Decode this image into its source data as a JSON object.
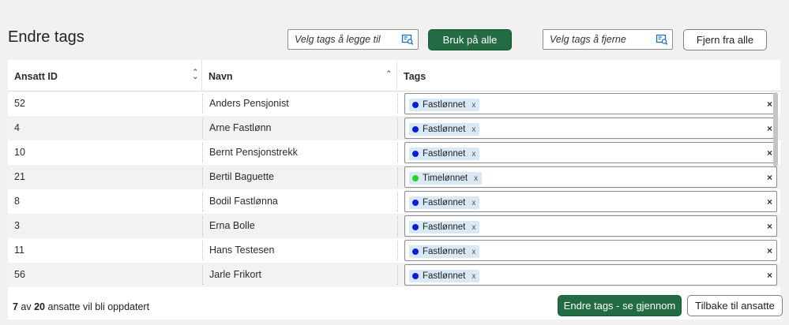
{
  "page": {
    "title": "Endre tags"
  },
  "toolbar": {
    "add_placeholder": "Velg tags å legge til",
    "apply_label": "Bruk på alle",
    "remove_placeholder": "Velg tags å fjerne",
    "remove_all_label": "Fjern fra alle"
  },
  "table": {
    "headers": {
      "id": "Ansatt ID",
      "name": "Navn",
      "tags": "Tags"
    },
    "rows": [
      {
        "id": "52",
        "name": "Anders Pensjonist",
        "tag": "Fastlønnet",
        "tag_color": "#0a1ed6"
      },
      {
        "id": "4",
        "name": "Arne Fastlønn",
        "tag": "Fastlønnet",
        "tag_color": "#0a1ed6"
      },
      {
        "id": "10",
        "name": "Bernt Pensjonstrekk",
        "tag": "Fastlønnet",
        "tag_color": "#0a1ed6"
      },
      {
        "id": "21",
        "name": "Bertil Baguette",
        "tag": "Timelønnet",
        "tag_color": "#1fd81f"
      },
      {
        "id": "8",
        "name": "Bodil Fastlønna",
        "tag": "Fastlønnet",
        "tag_color": "#0a1ed6"
      },
      {
        "id": "3",
        "name": "Erna Bolle",
        "tag": "Fastlønnet",
        "tag_color": "#0a1ed6"
      },
      {
        "id": "11",
        "name": "Hans Testesen",
        "tag": "Fastlønnet",
        "tag_color": "#0a1ed6"
      },
      {
        "id": "56",
        "name": "Jarle Frikort",
        "tag": "Fastlønnet",
        "tag_color": "#0a1ed6"
      }
    ],
    "chip_remove": "x",
    "clear": "×"
  },
  "footer": {
    "count": "7",
    "av": " av ",
    "total": "20",
    "suffix": " ansatte vil bli oppdatert",
    "review_label": "Endre tags - se gjennom",
    "back_label": "Tilbake til ansatte"
  },
  "colors": {
    "primary": "#236b43",
    "highlight": "#d0171c",
    "chip_bg": "#d9e8f5"
  }
}
